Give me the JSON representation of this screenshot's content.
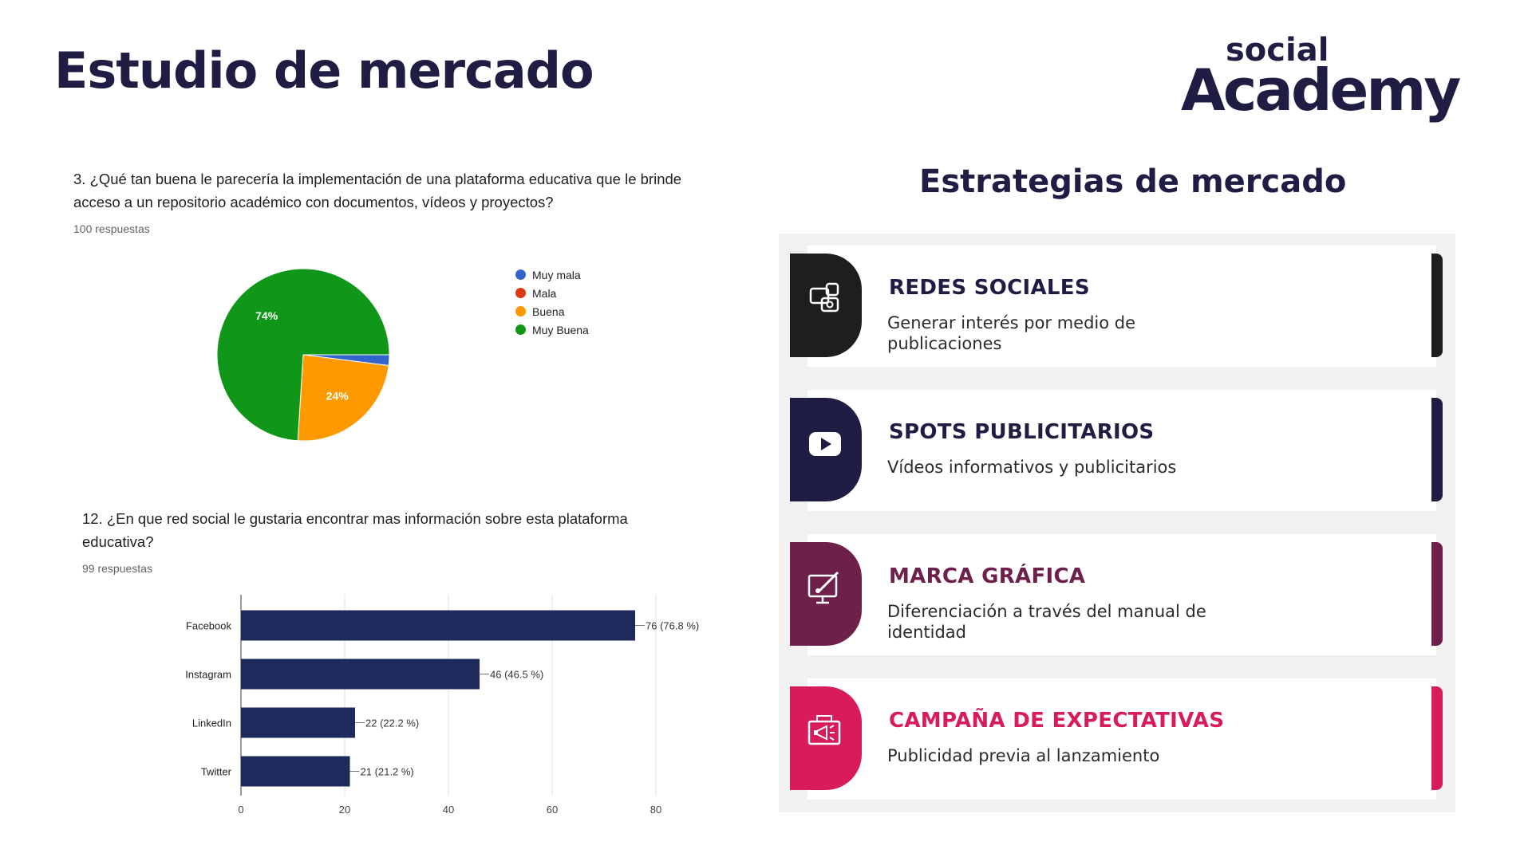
{
  "page": {
    "title": "Estudio de mercado"
  },
  "logo": {
    "line1": "social",
    "line2": "Academy",
    "color": "#1f1d44"
  },
  "survey1": {
    "question": "3. ¿Qué tan buena le parecería la implementación de una plataforma educativa que le brinde acceso a un repositorio académico con documentos, vídeos y proyectos?",
    "responses": "100 respuestas"
  },
  "survey2": {
    "question": "12. ¿En que red social le gustaria encontrar mas información sobre esta plataforma educativa?",
    "responses": "99 respuestas"
  },
  "chart_data": [
    {
      "type": "pie",
      "categories": [
        "Muy mala",
        "Mala",
        "Buena",
        "Muy Buena"
      ],
      "values": [
        2,
        0,
        24,
        74
      ],
      "value_labels": [
        "",
        "",
        "24%",
        "74%"
      ],
      "colors": [
        "#3366cc",
        "#dc3912",
        "#ff9900",
        "#109618"
      ],
      "legend": "right"
    },
    {
      "type": "bar",
      "orientation": "horizontal",
      "categories": [
        "Facebook",
        "Instagram",
        "LinkedIn",
        "Twitter"
      ],
      "values": [
        76,
        46,
        22,
        21
      ],
      "value_labels": [
        "76 (76.8 %)",
        "46 (46.5 %)",
        "22 (22.2 %)",
        "21 (21.2 %)"
      ],
      "xlim": [
        0,
        80
      ],
      "xticks": [
        0,
        20,
        40,
        60,
        80
      ],
      "color": "#1f2a5c",
      "grid": true
    }
  ],
  "strategies": {
    "title": "Estrategias de mercado",
    "items": [
      {
        "title": "REDES SOCIALES",
        "desc": "Generar interés por medio de publicaciones",
        "color": "#1e1e1e",
        "title_color": "#1f1d44",
        "icon": "social-media-icon"
      },
      {
        "title": "SPOTS PUBLICITARIOS",
        "desc": "Vídeos informativos y publicitarios",
        "color": "#1f1d44",
        "title_color": "#1f1d44",
        "icon": "play-video-icon"
      },
      {
        "title": "MARCA GRÁFICA",
        "desc": "Diferenciación a través del manual de identidad",
        "color": "#6e1f4a",
        "title_color": "#6e1f4a",
        "icon": "design-monitor-icon"
      },
      {
        "title": "CAMPAÑA DE EXPECTATIVAS",
        "desc": "Publicidad previa al lanzamiento",
        "color": "#d81b5a",
        "title_color": "#d81b5a",
        "icon": "megaphone-screen-icon"
      }
    ]
  }
}
